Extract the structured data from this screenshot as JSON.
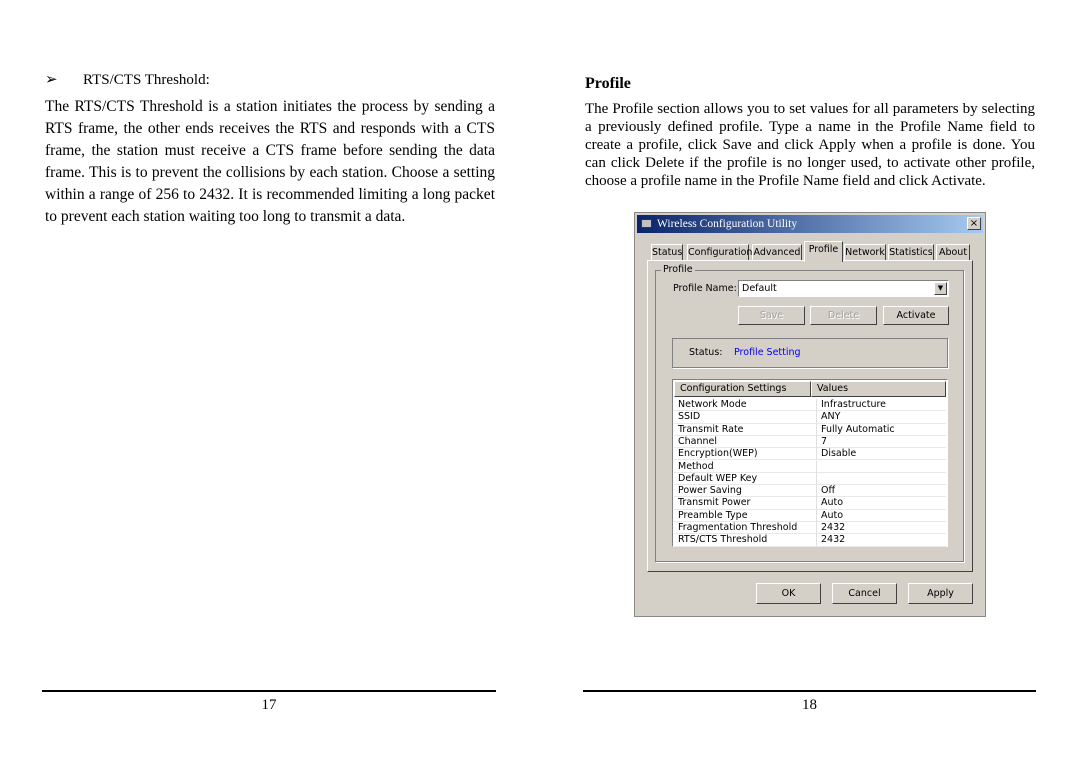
{
  "left_page": {
    "bullet_heading": "RTS/CTS Threshold:",
    "bullet_icon": "arrow-bullet-icon",
    "paragraph": "The RTS/CTS Threshold is a station initiates the process by sending a RTS frame, the other ends receives the RTS and responds with a CTS frame, the station must receive a CTS frame before sending the data frame. This is to prevent the collisions by each station. Choose a setting within a range of 256 to 2432. It is recommended limiting a long packet to prevent each station waiting too long to transmit a data.",
    "page_number": "17"
  },
  "right_page": {
    "heading": "Profile",
    "paragraph": "The Profile section allows you to set values for all parameters by selecting a previously defined profile. Type a name in the Profile Name field to create a profile, click Save and click Apply when a profile is done. You can click Delete if the profile is no longer used, to activate other profile, choose a profile name in the Profile Name field and click Activate.",
    "page_number": "18"
  },
  "dialog": {
    "title": "Wireless Configuration Utility",
    "close": "×",
    "tabs": [
      "Status",
      "Configuration",
      "Advanced",
      "Profile",
      "Network",
      "Statistics",
      "About"
    ],
    "active_tab": "Profile",
    "group_label": "Profile",
    "profile_name_label": "Profile Name:",
    "profile_name_value": "Default",
    "save": "Save",
    "delete": "Delete",
    "activate": "Activate",
    "status_label": "Status:",
    "status_value": "Profile Setting",
    "status_color": "#0000ff",
    "columns": [
      "Configuration Settings",
      "Values"
    ],
    "rows": [
      [
        "Network Mode",
        "Infrastructure"
      ],
      [
        "SSID",
        "ANY"
      ],
      [
        "Transmit Rate",
        "Fully Automatic"
      ],
      [
        "Channel",
        "7"
      ],
      [
        "Encryption(WEP)",
        "Disable"
      ],
      [
        "Method",
        ""
      ],
      [
        "Default WEP Key",
        ""
      ],
      [
        "Power Saving",
        "Off"
      ],
      [
        "Transmit Power",
        "Auto"
      ],
      [
        "Preamble Type",
        "Auto"
      ],
      [
        "Fragmentation Threshold",
        "2432"
      ],
      [
        "RTS/CTS Threshold",
        "2432"
      ]
    ],
    "ok": "OK",
    "cancel": "Cancel",
    "apply": "Apply"
  }
}
